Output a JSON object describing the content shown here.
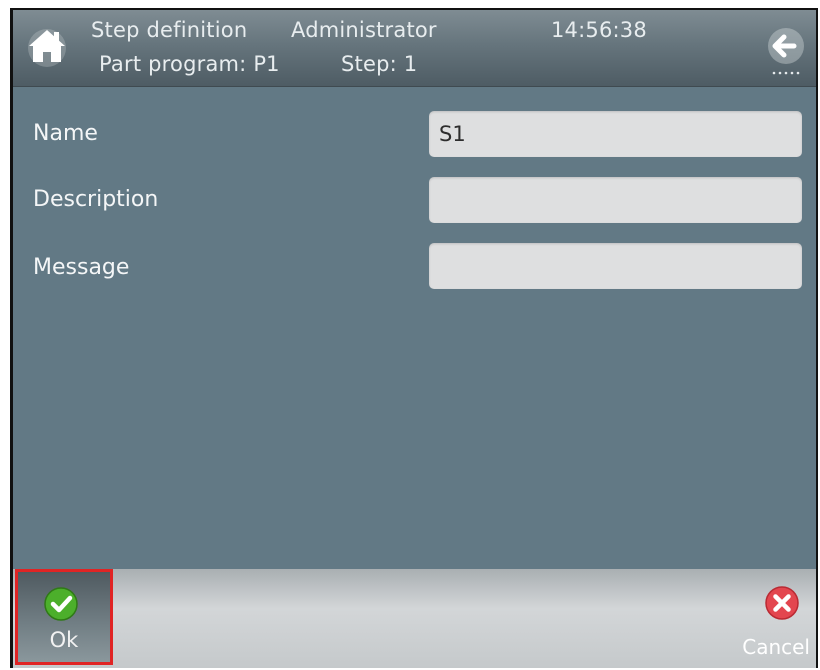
{
  "header": {
    "screen_title": "Step definition",
    "user": "Administrator",
    "time": "14:56:38",
    "part_program": "Part program: P1",
    "step": "Step: 1"
  },
  "form": {
    "fields": [
      {
        "label": "Name",
        "value": "S1"
      },
      {
        "label": "Description",
        "value": ""
      },
      {
        "label": "Message",
        "value": ""
      }
    ]
  },
  "footer": {
    "ok_label": "Ok",
    "cancel_label": "Cancel"
  },
  "icons": {
    "home": "home-icon",
    "back": "back-arrow-icon",
    "ok": "checkmark-icon",
    "cancel": "close-icon"
  },
  "colors": {
    "content_bg": "#627985",
    "ok_highlight": "#e02424",
    "ok_green": "#4caf2b",
    "cancel_red": "#e3464f"
  }
}
